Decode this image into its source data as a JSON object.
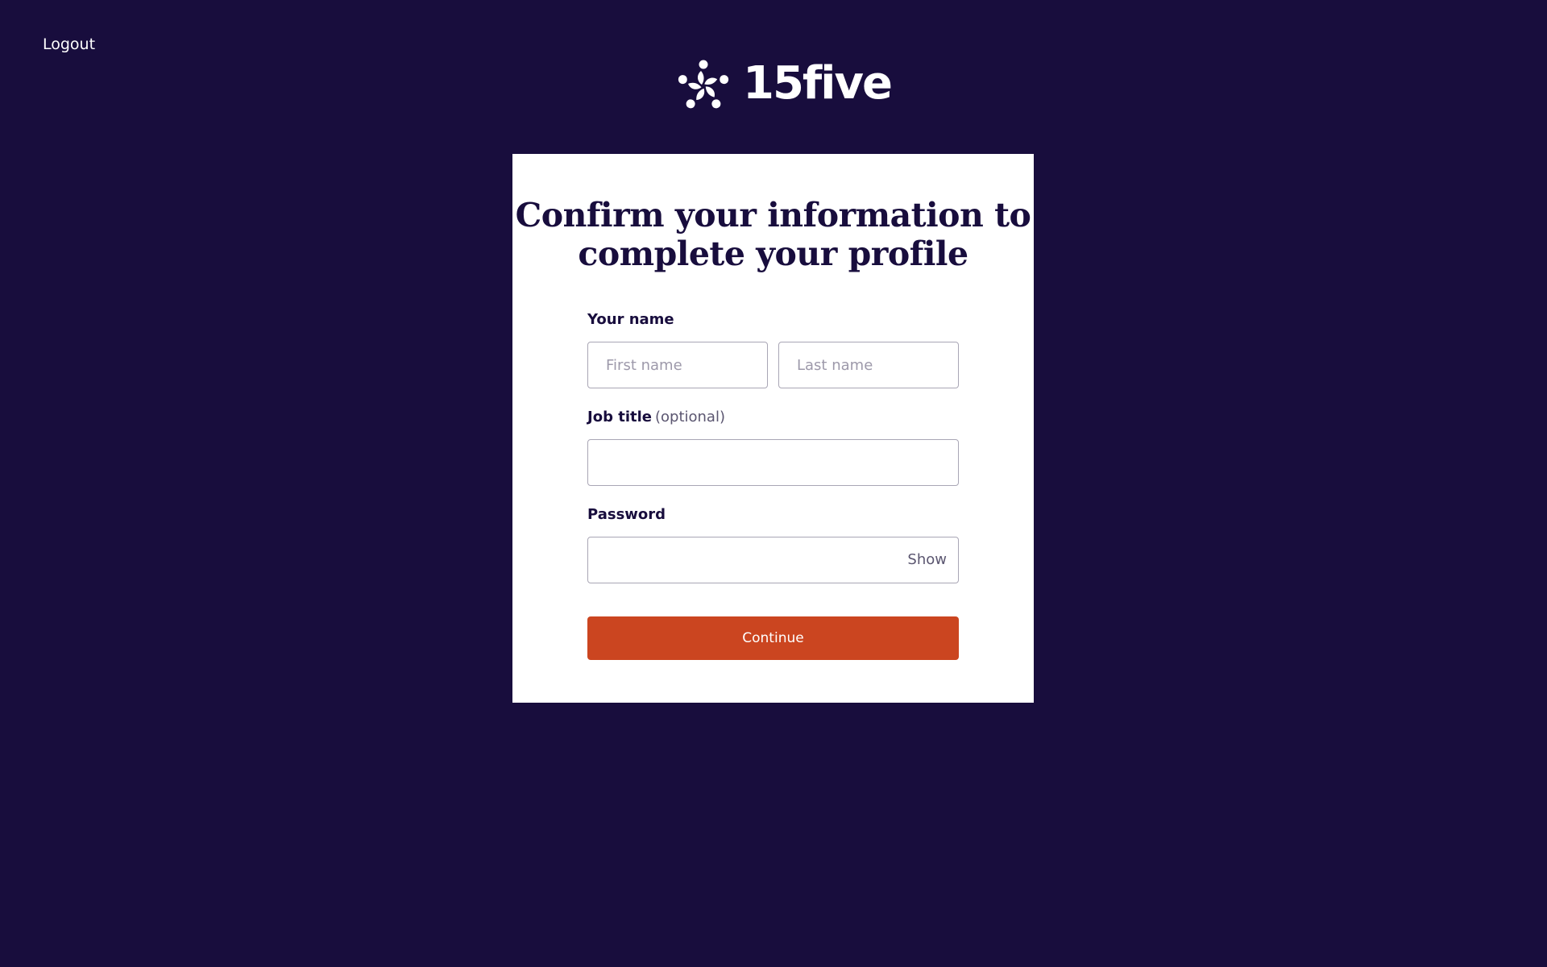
{
  "header": {
    "logout_label": "Logout",
    "logo_text": "15five"
  },
  "form": {
    "title": "Confirm your information to complete your profile",
    "name_label": "Your name",
    "first_name_placeholder": "First name",
    "first_name_value": "",
    "last_name_placeholder": "Last name",
    "last_name_value": "",
    "job_title_label": "Job title",
    "job_title_optional": "(optional)",
    "job_title_value": "",
    "password_label": "Password",
    "password_value": "",
    "show_label": "Show",
    "continue_label": "Continue"
  },
  "colors": {
    "background": "#180d3d",
    "card": "#ffffff",
    "accent": "#cb4520",
    "text": "#180d3d"
  },
  "icons": {
    "logo": "15five-logo-icon"
  }
}
